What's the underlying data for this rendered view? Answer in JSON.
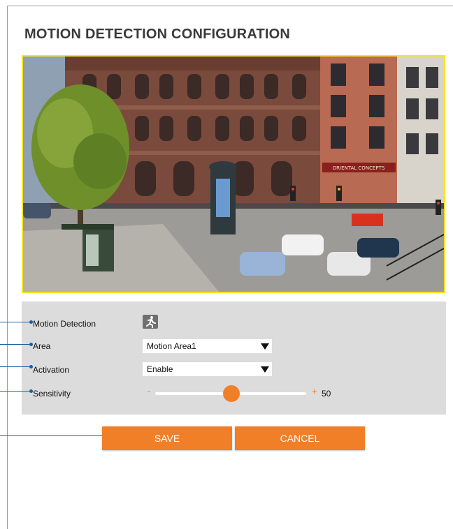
{
  "page": {
    "title": "MOTION DETECTION CONFIGURATION"
  },
  "preview": {
    "image_description": "live camera view of a street junction with historic brick buildings, a tree, traffic lights and parked cars",
    "store_sign": "ORIENTAL CONCEPTS"
  },
  "settings": {
    "motion_detection": {
      "label": "Motion Detection",
      "icon": "running-person-icon"
    },
    "area": {
      "label": "Area",
      "value": "Motion Area1"
    },
    "activation": {
      "label": "Activation",
      "value": "Enable"
    },
    "sensitivity": {
      "label": "Sensitivity",
      "minus": "-",
      "plus": "+",
      "value": 50,
      "value_text": "50",
      "min": 0,
      "max": 100
    }
  },
  "buttons": {
    "save": "SAVE",
    "cancel": "CANCEL"
  },
  "colors": {
    "accent": "#f07f28",
    "preview_border": "#f3e620",
    "panel_bg": "#dcdcdc",
    "leader_line": "#1a5fa0"
  }
}
